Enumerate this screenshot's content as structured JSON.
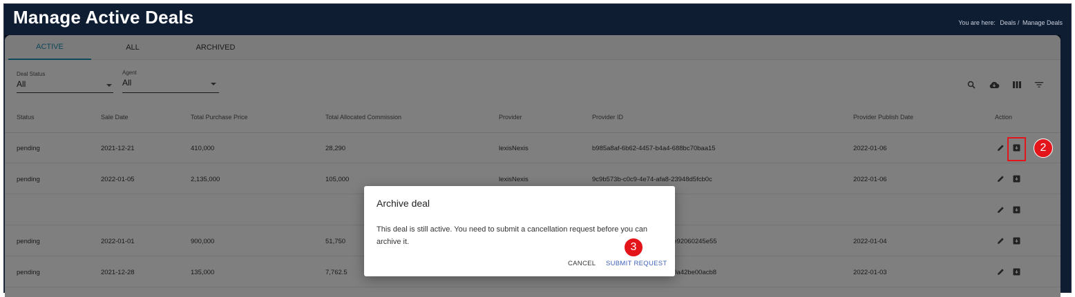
{
  "header": {
    "title": "Manage Active Deals"
  },
  "breadcrumb": {
    "prefix": "You are here:",
    "items": [
      "Deals /",
      "Manage Deals"
    ]
  },
  "tabs": [
    {
      "label": "ACTIVE"
    },
    {
      "label": "ALL"
    },
    {
      "label": "ARCHIVED"
    }
  ],
  "filters": {
    "deal_status": {
      "label": "Deal Status",
      "value": "All"
    },
    "agent": {
      "label": "Agent",
      "value": "All"
    }
  },
  "toolbar_icons": [
    "search-icon",
    "cloud-download-icon",
    "columns-icon",
    "filter-icon"
  ],
  "table": {
    "columns": [
      "Status",
      "Sale Date",
      "Total Purchase Price",
      "Total Allocated Commission",
      "Provider",
      "Provider ID",
      "Provider Publish Date",
      "Action"
    ],
    "rows": [
      {
        "status": "pending",
        "sale_date": "2021-12-21",
        "price": "410,000",
        "commission": "28,290",
        "provider": "lexisNexis",
        "provider_id": "b985a8af-6b62-4457-b4a4-688bc70baa15",
        "publish_date": "2022-01-06"
      },
      {
        "status": "pending",
        "sale_date": "2022-01-05",
        "price": "2,135,000",
        "commission": "105,000",
        "provider": "lexisNexis",
        "provider_id": "9c9b573b-c0c9-4e74-afa8-23948d5fcb0c",
        "publish_date": "2022-01-06"
      },
      {
        "status": "",
        "sale_date": "",
        "price": "",
        "commission": "",
        "provider": "",
        "provider_id": "",
        "publish_date": ""
      },
      {
        "status": "pending",
        "sale_date": "2022-01-01",
        "price": "900,000",
        "commission": "51,750",
        "provider": "",
        "provider_id": "-e92060245e55",
        "publish_date": "2022-01-04"
      },
      {
        "status": "pending",
        "sale_date": "2021-12-28",
        "price": "135,000",
        "commission": "7,762.5",
        "provider": "",
        "provider_id": "-0a42be00acb8",
        "publish_date": "2022-01-03"
      }
    ]
  },
  "dialog": {
    "title": "Archive deal",
    "body": "This deal is still active. You need to submit a cancellation request before you can archive it.",
    "cancel_label": "CANCEL",
    "submit_label": "SUBMIT REQUEST"
  },
  "annotations": {
    "marker_2": "2",
    "marker_3": "3"
  },
  "colors": {
    "header_bg": "#0f1d33",
    "accent": "#1d8fb3",
    "submit": "#3d5fb8",
    "marker": "#e3151b"
  }
}
